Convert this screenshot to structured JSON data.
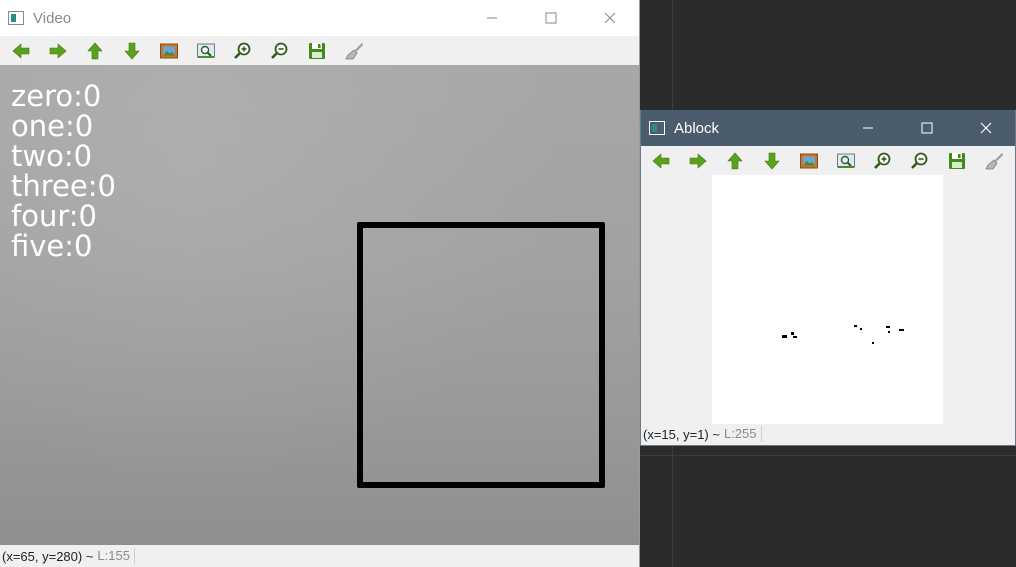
{
  "video_window": {
    "title": "Video",
    "toolbar": [
      {
        "icon": "arrow-left-icon"
      },
      {
        "icon": "arrow-right-icon"
      },
      {
        "icon": "arrow-up-icon"
      },
      {
        "icon": "arrow-down-icon"
      },
      {
        "icon": "image-icon"
      },
      {
        "icon": "zoom-region-icon"
      },
      {
        "icon": "zoom-in-icon"
      },
      {
        "icon": "zoom-out-icon"
      },
      {
        "icon": "save-icon"
      },
      {
        "icon": "properties-brush-icon"
      }
    ],
    "counters": [
      "zero:0",
      "one:0",
      "two:0",
      "three:0",
      "four:0",
      "five:0"
    ],
    "status": {
      "coords": "(x=65, y=280) ~",
      "value": "L:155"
    }
  },
  "ablock_window": {
    "title": "Ablock",
    "status": {
      "coords": "(x=15, y=1) ~",
      "value": "L:255"
    }
  },
  "colors": {
    "active_titlebar": "#4b5c6c",
    "toolbar_green": "#5aa21c",
    "roi_border": "#000000"
  }
}
